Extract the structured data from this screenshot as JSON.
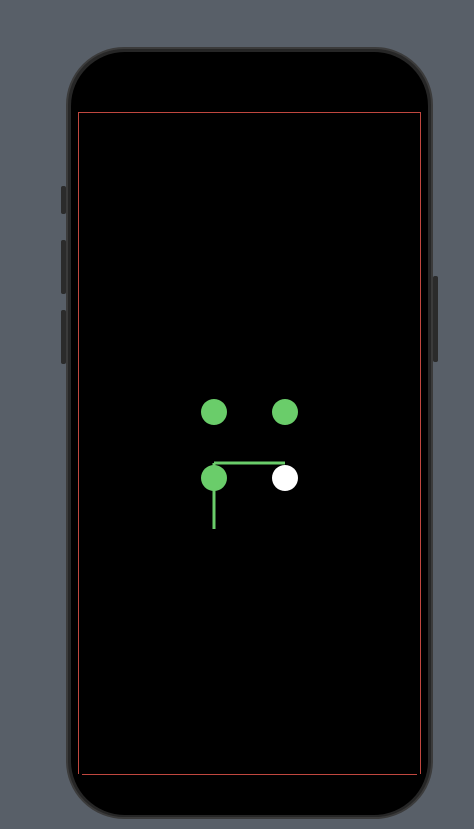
{
  "colors": {
    "background": "#585f68",
    "screen": "#000000",
    "guide": "#c0473f",
    "dot_selected": "#6acd6a",
    "dot_current": "#ffffff",
    "stroke": "#6acd6a"
  },
  "pattern": {
    "dots": [
      {
        "name": "pattern-dot-top-left",
        "state": "selected"
      },
      {
        "name": "pattern-dot-top-right",
        "state": "selected"
      },
      {
        "name": "pattern-dot-bottom-left",
        "state": "selected"
      },
      {
        "name": "pattern-dot-bottom-right",
        "state": "current"
      }
    ]
  }
}
